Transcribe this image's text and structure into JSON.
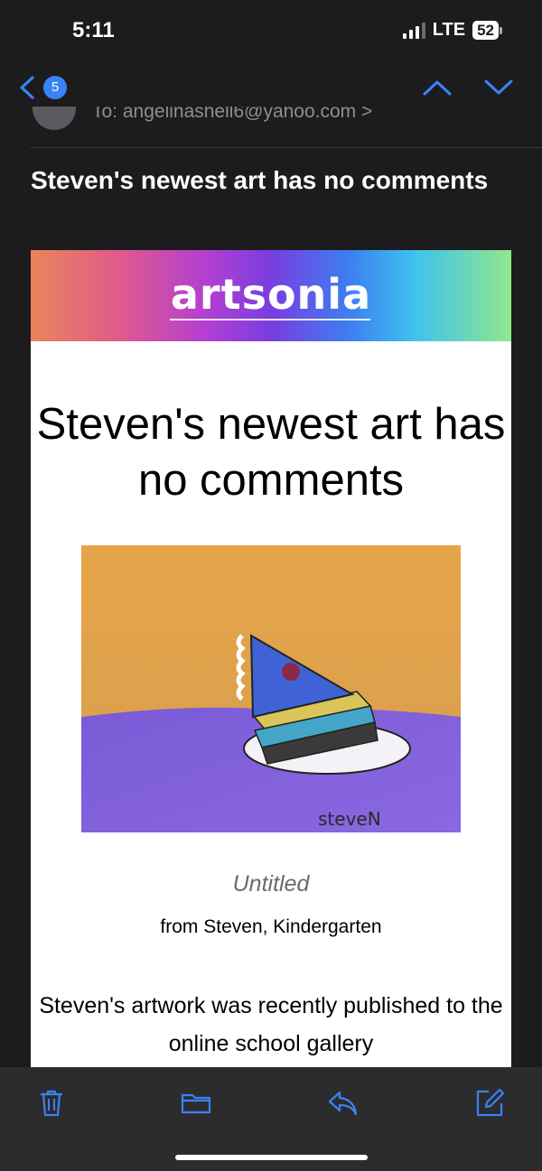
{
  "status_bar": {
    "time": "5:11",
    "network": "LTE",
    "battery": "52"
  },
  "nav": {
    "back_count": "5",
    "icons": [
      "chevron-left-icon",
      "chevron-up-icon",
      "chevron-down-icon"
    ]
  },
  "email": {
    "to_line": "To: angelinashell6@yahoo.com >",
    "subject": "Steven's newest art has no comments"
  },
  "card": {
    "logo": "artsonia",
    "headline": "Steven's newest art has no comments",
    "artwork_signature": "steveN",
    "art_title": "Untitled",
    "art_from": "from Steven, Kindergarten",
    "body_text": "Steven's artwork was recently published to the online school gallery"
  },
  "toolbar": {
    "icons": [
      "trash-icon",
      "folder-icon",
      "reply-icon",
      "compose-icon"
    ]
  },
  "colors": {
    "accent": "#3a82f7",
    "background": "#1c1c1e",
    "toolbar": "#2c2c2e"
  }
}
